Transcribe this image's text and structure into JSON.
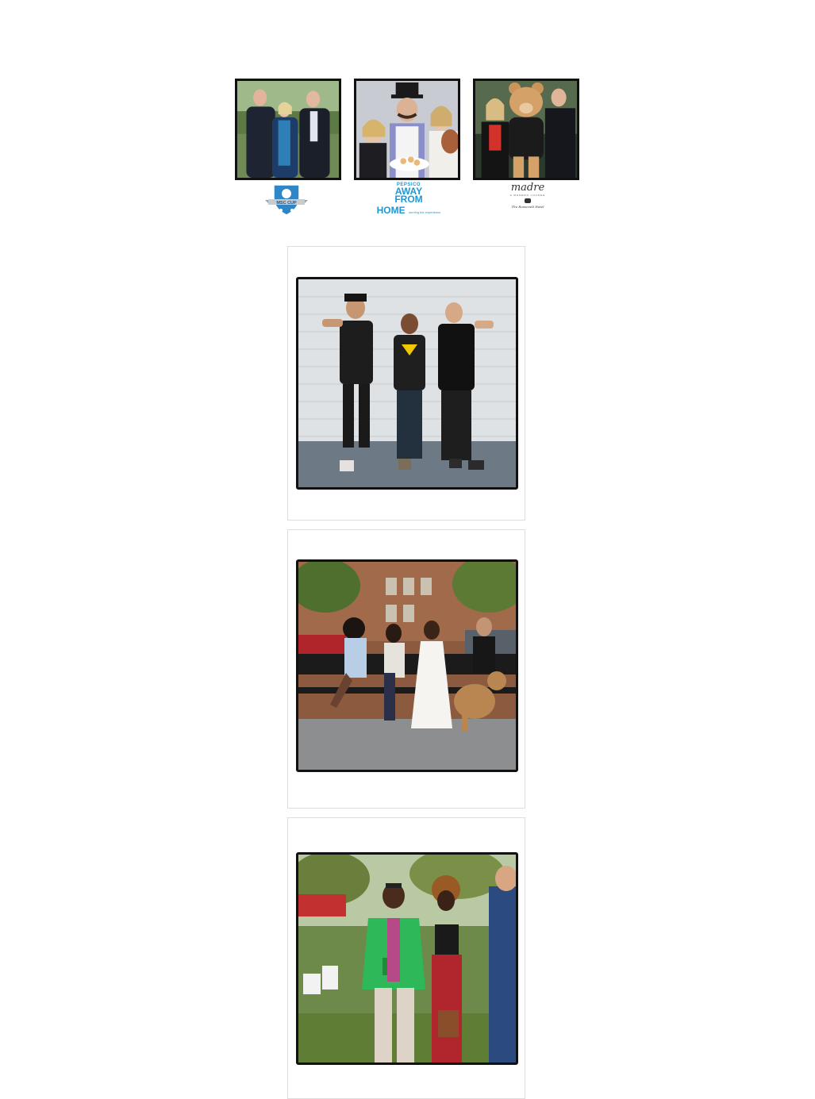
{
  "booth_samples": [
    {
      "logo": "msc-cup-logo",
      "logo_text": "MSC CUP"
    },
    {
      "logo": "pepsico-away-from-home-logo",
      "brand": "PEPSICO",
      "line1": "AWAY",
      "line2": "FROM",
      "line3": "HOME",
      "tagline": "serving the experience"
    },
    {
      "logo": "madre-roosevelt-hotel-logo",
      "name": "madre",
      "sub": "A MODERN LOUNGE",
      "hotel": "The Roosevelt Hotel"
    }
  ],
  "cards": [
    {
      "image": "three-men-street-pose-photo"
    },
    {
      "image": "women-on-park-bench-with-dog-photo"
    },
    {
      "image": "couple-at-outdoor-festival-photo"
    }
  ]
}
